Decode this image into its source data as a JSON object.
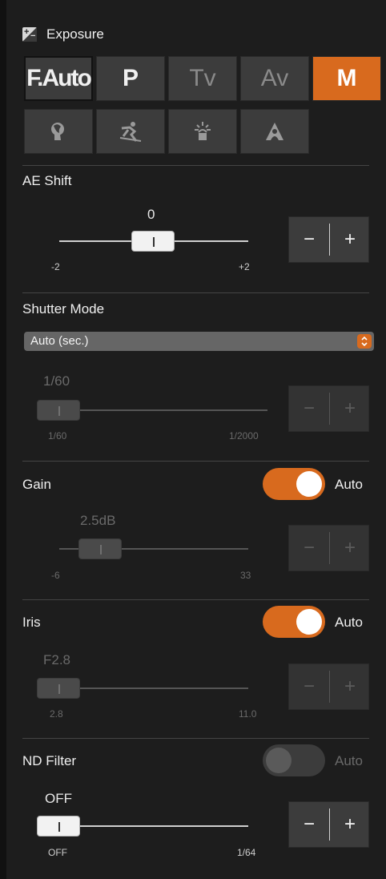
{
  "header": {
    "title": "Exposure",
    "icon": "exposure-compensation-icon"
  },
  "modes": [
    {
      "label": "F.Auto",
      "state": "outlined"
    },
    {
      "label": "P",
      "state": "normal"
    },
    {
      "label": "Tv",
      "state": "dim"
    },
    {
      "label": "Av",
      "state": "dim"
    },
    {
      "label": "M",
      "state": "active"
    }
  ],
  "scene_modes": [
    "portrait-icon",
    "sports-icon",
    "spotlight-icon",
    "landscape-icon"
  ],
  "ae_shift": {
    "label": "AE Shift",
    "value": "0",
    "min_label": "-2",
    "max_label": "+2",
    "minus": "−",
    "plus": "+",
    "position_fraction": 0.5,
    "enabled": true
  },
  "shutter": {
    "label": "Shutter Mode",
    "select_value": "Auto (sec.)",
    "value": "1/60",
    "min_label": "1/60",
    "max_label": "1/2000",
    "minus": "−",
    "plus": "+",
    "position_fraction": 0.0,
    "enabled": false
  },
  "gain": {
    "label": "Gain",
    "auto_label": "Auto",
    "auto_on": true,
    "value": "2.5dB",
    "min_label": "-6",
    "max_label": "33",
    "minus": "−",
    "plus": "+",
    "position_fraction": 0.22,
    "enabled": false
  },
  "iris": {
    "label": "Iris",
    "auto_label": "Auto",
    "auto_on": true,
    "value": "F2.8",
    "min_label": "2.8",
    "max_label": "11.0",
    "minus": "−",
    "plus": "+",
    "position_fraction": 0.0,
    "enabled": false
  },
  "nd_filter": {
    "label": "ND Filter",
    "auto_label": "Auto",
    "auto_on": false,
    "value": "OFF",
    "min_label": "OFF",
    "max_label": "1/64",
    "minus": "−",
    "plus": "+",
    "position_fraction": 0.0,
    "enabled": true
  },
  "colors": {
    "accent": "#d86a1e",
    "background": "#1d1d1d",
    "button": "#3c3c3c"
  }
}
